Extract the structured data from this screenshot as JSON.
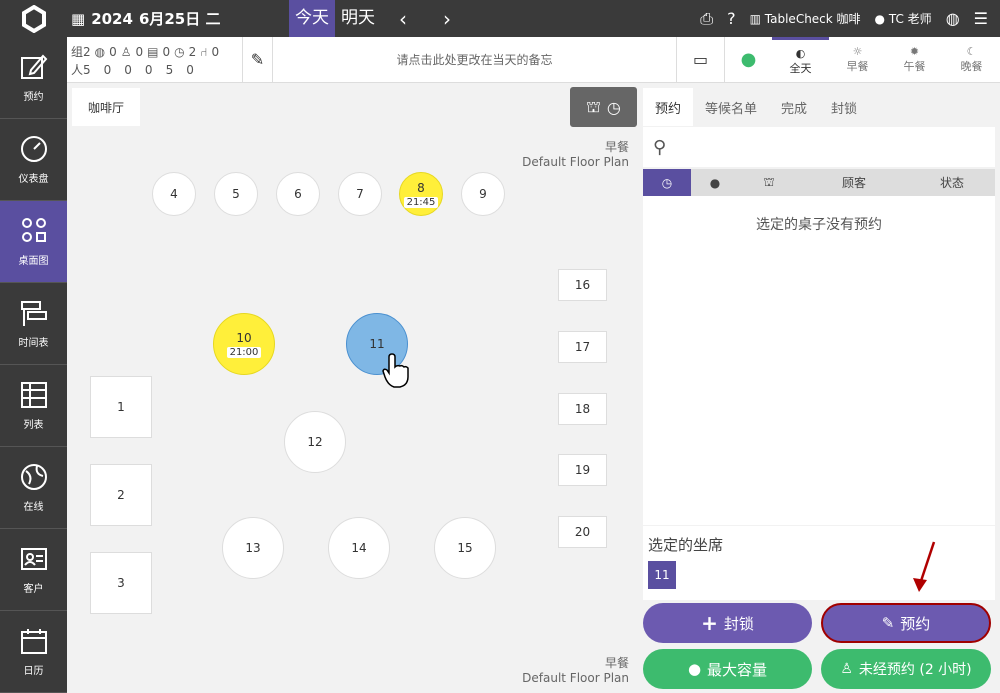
{
  "topbar": {
    "year": "2024",
    "date": "6月25日 二",
    "today": "今天",
    "tomorrow": "明天",
    "restaurant": "TableCheck 咖啡",
    "user": "TC 老师"
  },
  "sidebar": [
    {
      "label": "预约",
      "icon": "pencil-edit-icon"
    },
    {
      "label": "仪表盘",
      "icon": "gauge-icon"
    },
    {
      "label": "桌面图",
      "icon": "shapes-icon"
    },
    {
      "label": "时间表",
      "icon": "timeline-icon"
    },
    {
      "label": "列表",
      "icon": "table-list-icon"
    },
    {
      "label": "在线",
      "icon": "globe-icon"
    },
    {
      "label": "客户",
      "icon": "contact-card-icon"
    },
    {
      "label": "日历",
      "icon": "calendar-icon"
    }
  ],
  "stats": {
    "row1": [
      "组2",
      "0",
      "0",
      "0",
      "2",
      "0"
    ],
    "row2": [
      "人5",
      "0",
      "0",
      "0",
      "5",
      "0"
    ]
  },
  "memo": "请点击此处更改在当天的备忘",
  "meals": [
    "全天",
    "早餐",
    "午餐",
    "晚餐"
  ],
  "floor": {
    "tab": "咖啡厅",
    "plan_meal": "早餐",
    "plan_name": "Default Floor Plan"
  },
  "tables": [
    {
      "id": "4"
    },
    {
      "id": "5"
    },
    {
      "id": "6"
    },
    {
      "id": "7"
    },
    {
      "id": "8",
      "time": "21:45"
    },
    {
      "id": "9"
    },
    {
      "id": "10",
      "time": "21:00"
    },
    {
      "id": "11"
    },
    {
      "id": "12"
    },
    {
      "id": "13"
    },
    {
      "id": "14"
    },
    {
      "id": "15"
    },
    {
      "id": "1"
    },
    {
      "id": "2"
    },
    {
      "id": "3"
    },
    {
      "id": "16"
    },
    {
      "id": "17"
    },
    {
      "id": "18"
    },
    {
      "id": "19"
    },
    {
      "id": "20"
    }
  ],
  "right": {
    "tabs": [
      "预约",
      "等候名单",
      "完成",
      "封锁"
    ],
    "cols": [
      "顾客",
      "状态"
    ],
    "empty": "选定的桌子没有预约",
    "selected_title": "选定的坐席",
    "selected_table": "11"
  },
  "buttons": {
    "block": "封锁",
    "reserve": "预约",
    "capacity": "最大容量",
    "walkin": "未经预约 (2 小时)"
  },
  "colors": {
    "accent": "#5a4fa0",
    "reserved": "#ffef3a",
    "selected": "#7fb7e5",
    "green": "#3dbb6e"
  }
}
